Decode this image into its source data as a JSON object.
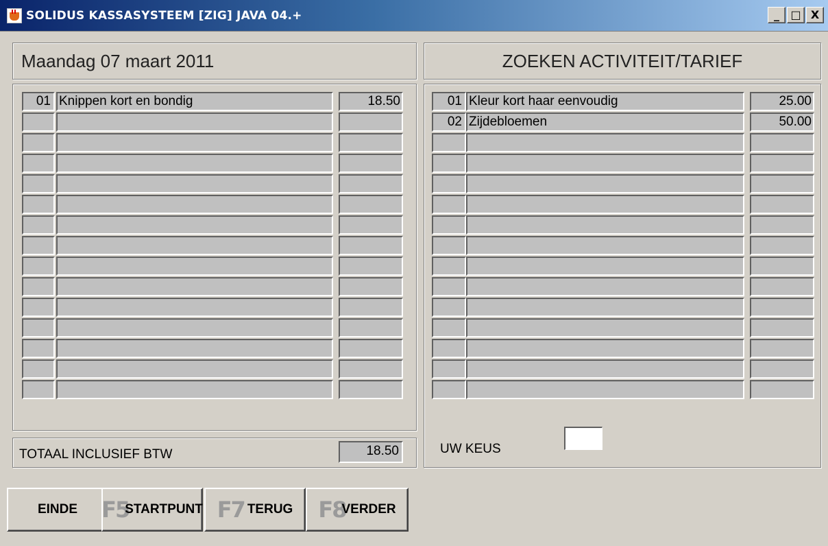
{
  "window": {
    "title": "SOLIDUS KASSASYSTEEM [ZIG] JAVA 04.+",
    "minimize_label": "_",
    "maximize_label": "□",
    "close_label": "X"
  },
  "left": {
    "date": "Maandag 07 maart 2011",
    "rows": [
      {
        "num": "01",
        "desc": "Knippen kort en bondig",
        "amount": "18.50"
      },
      {
        "num": "",
        "desc": "",
        "amount": ""
      },
      {
        "num": "",
        "desc": "",
        "amount": ""
      },
      {
        "num": "",
        "desc": "",
        "amount": ""
      },
      {
        "num": "",
        "desc": "",
        "amount": ""
      },
      {
        "num": "",
        "desc": "",
        "amount": ""
      },
      {
        "num": "",
        "desc": "",
        "amount": ""
      },
      {
        "num": "",
        "desc": "",
        "amount": ""
      },
      {
        "num": "",
        "desc": "",
        "amount": ""
      },
      {
        "num": "",
        "desc": "",
        "amount": ""
      },
      {
        "num": "",
        "desc": "",
        "amount": ""
      },
      {
        "num": "",
        "desc": "",
        "amount": ""
      },
      {
        "num": "",
        "desc": "",
        "amount": ""
      },
      {
        "num": "",
        "desc": "",
        "amount": ""
      },
      {
        "num": "",
        "desc": "",
        "amount": ""
      }
    ],
    "total_label": "TOTAAL INCLUSIEF BTW",
    "total_value": "18.50"
  },
  "right": {
    "title": "ZOEKEN ACTIVITEIT/TARIEF",
    "rows": [
      {
        "num": "01",
        "desc": "Kleur kort haar eenvoudig",
        "amount": "25.00"
      },
      {
        "num": "02",
        "desc": "Zijdebloemen",
        "amount": "50.00"
      },
      {
        "num": "",
        "desc": "",
        "amount": ""
      },
      {
        "num": "",
        "desc": "",
        "amount": ""
      },
      {
        "num": "",
        "desc": "",
        "amount": ""
      },
      {
        "num": "",
        "desc": "",
        "amount": ""
      },
      {
        "num": "",
        "desc": "",
        "amount": ""
      },
      {
        "num": "",
        "desc": "",
        "amount": ""
      },
      {
        "num": "",
        "desc": "",
        "amount": ""
      },
      {
        "num": "",
        "desc": "",
        "amount": ""
      },
      {
        "num": "",
        "desc": "",
        "amount": ""
      },
      {
        "num": "",
        "desc": "",
        "amount": ""
      },
      {
        "num": "",
        "desc": "",
        "amount": ""
      },
      {
        "num": "",
        "desc": "",
        "amount": ""
      },
      {
        "num": "",
        "desc": "",
        "amount": ""
      }
    ],
    "choice_label": "UW KEUS",
    "choice_value": ""
  },
  "buttons": {
    "einde": {
      "key": "",
      "label": "EINDE"
    },
    "startpunt": {
      "key": "F5",
      "label": "STARTPUNT"
    },
    "terug": {
      "key": "F7",
      "label": "TERUG"
    },
    "verder": {
      "key": "F8",
      "label": "VERDER"
    }
  }
}
